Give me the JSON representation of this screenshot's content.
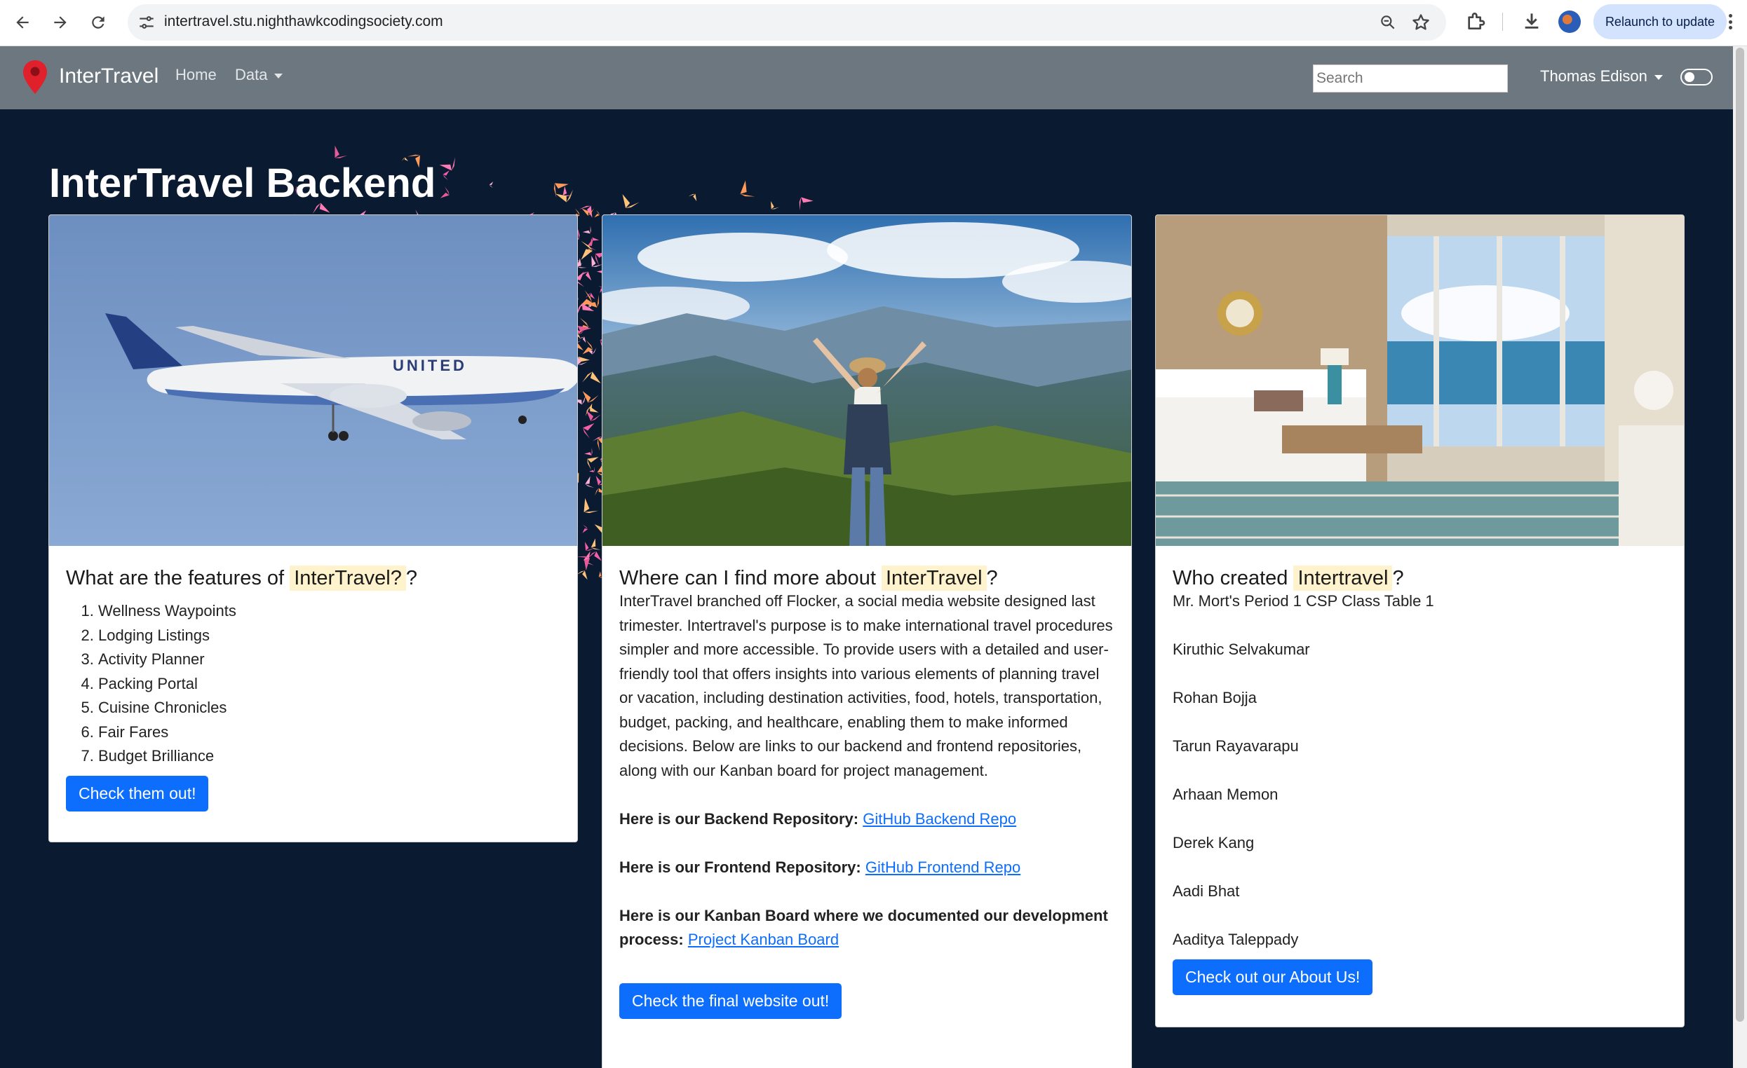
{
  "browser": {
    "url": "intertravel.stu.nighthawkcodingsociety.com",
    "relaunch_label": "Relaunch to update"
  },
  "navbar": {
    "brand": "InterTravel",
    "home": "Home",
    "data": "Data",
    "search_placeholder": "Search",
    "user": "Thomas Edison"
  },
  "page": {
    "title": "InterTravel Backend"
  },
  "card1": {
    "heading_pre": "What are the features of",
    "heading_hl": "InterTravel?",
    "heading_post": "?",
    "features": [
      "Wellness Waypoints",
      "Lodging Listings",
      "Activity Planner",
      "Packing Portal",
      "Cuisine Chronicles",
      "Fair Fares",
      "Budget Brilliance"
    ],
    "button": "Check them out!"
  },
  "card2": {
    "heading_pre": "Where can I find more about",
    "heading_hl": "InterTravel",
    "heading_post": "?",
    "description": "InterTravel branched off Flocker, a social media website designed last trimester. Intertravel's purpose is to make international travel procedures simpler and more accessible. To provide users with a detailed and user-friendly tool that offers insights into various elements of planning travel or vacation, including destination activities, food, hotels, transportation, budget, packing, and healthcare, enabling them to make informed decisions. Below are links to our backend and frontend repositories, along with our Kanban board for project management.",
    "backend_label": "Here is our Backend Repository:",
    "backend_link": "GitHub Backend Repo",
    "frontend_label": "Here is our Frontend Repository:",
    "frontend_link": "GitHub Frontend Repo",
    "kanban_label": "Here is our Kanban Board where we documented our development process:",
    "kanban_link": "Project Kanban Board",
    "button": "Check the final website out!"
  },
  "card3": {
    "heading_pre": "Who created",
    "heading_hl": "Intertravel",
    "heading_post": "?",
    "subtitle": "Mr. Mort's Period 1 CSP Class Table 1",
    "members": [
      "Kiruthic Selvakumar",
      "Rohan Bojja",
      "Tarun Rayavarapu",
      "Arhaan Memon",
      "Derek Kang",
      "Aadi Bhat",
      "Aaditya Taleppady"
    ],
    "button": "Check out our About Us!"
  },
  "icons": {
    "back": "back-arrow-icon",
    "forward": "forward-arrow-icon",
    "reload": "reload-icon",
    "site_info": "tune-icon",
    "zoom": "zoom-icon",
    "bookmark": "star-icon",
    "extensions": "puzzle-icon",
    "download": "download-icon",
    "brand": "map-pin-icon"
  },
  "colors": {
    "background": "#0a1a30",
    "navbar": "#6c7780",
    "button": "#0d6efd",
    "highlight": "#fff3cd"
  }
}
